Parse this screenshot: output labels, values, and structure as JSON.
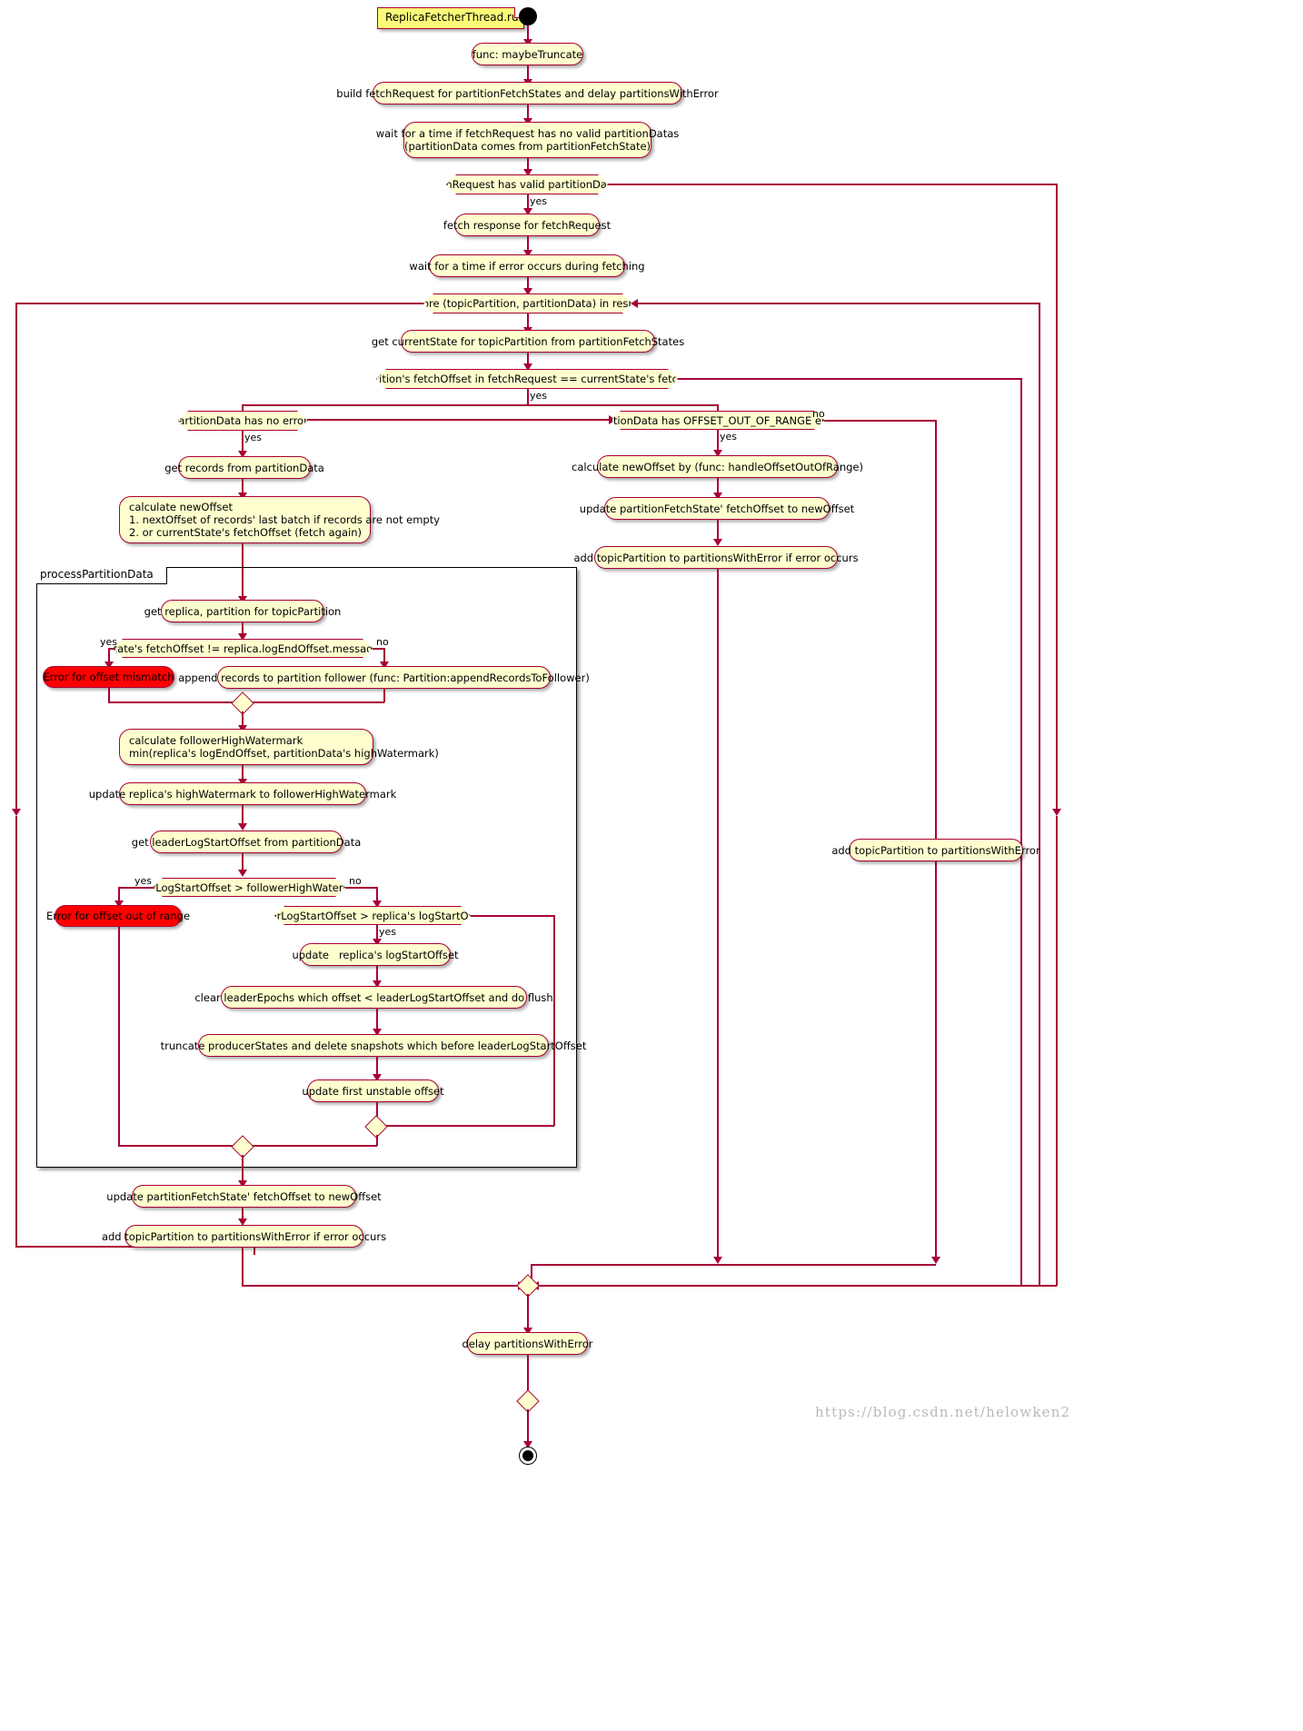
{
  "diagram": {
    "title_note": "ReplicaFetcherThread.run",
    "partition_label": "processPartitionData",
    "watermark": "https://blog.csdn.net/helowken2",
    "colors": {
      "node_fill": "#FEFECE",
      "node_border": "#A80036",
      "note_fill": "#FBFB77",
      "error_fill": "#FF0000",
      "group_border": "#000000"
    }
  },
  "nodes": {
    "maybe_truncate": "func: maybeTruncate",
    "build_fetch_request": "build fetchRequest for partitionFetchStates and delay partitionsWithError",
    "wait_no_valid": "wait for a time if fetchRequest has no valid partitionDatas\n(partitionData comes from partitionFetchState)",
    "cond_valid_partition_datas": "fetchRequest has valid partitionDatas?",
    "fetch_response": "fetch response for fetchRequest",
    "wait_error_fetching": "wait for a time if error occurs during fetching",
    "cond_has_more": "has more (topicPartition, partitionData) in response?",
    "get_current_state": "get currentState for topicPartition from partitionFetchStates",
    "cond_fetchoffset_equal": "topicPartition's fetchOffset in fetchRequest == currentState's fetchOffset?",
    "cond_no_error": "partitionData has no error?",
    "get_records": "get records from partitionData",
    "calculate_new_offset": "calculate newOffset\n1. nextOffset of records' last batch if records are not empty\n2. or currentState's fetchOffset (fetch again)",
    "cond_offset_out_of_range": "partitionData has OFFSET_OUT_OF_RANGE error?",
    "calc_new_offset_handle": "calculate newOffset by (func: handleOffsetOutOfRange)",
    "update_fetchoffset_right": "update partitionFetchState' fetchOffset to newOffset",
    "add_partitions_with_error_right": "add topicPartition to partitionsWithError if error occurs",
    "add_partitions_with_error_far": "add topicPartition to partitionsWithError",
    "get_replica_partition": "get replica, partition for topicPartition",
    "cond_offset_mismatch": "currentState's fetchOffset != replica.logEndOffset.messageOffset?",
    "error_offset_mismatch": "Error for offset mismatch",
    "append_records": "append records to partition follower (func: Partition:appendRecordsToFollower)",
    "calc_follower_hw": "calculate followerHighWatermark\nmin(replica's logEndOffset, partitionData's highWatermark)",
    "update_replica_hw": "update replica's highWatermark to followerHighWatermark",
    "get_leader_log_start_offset": "get leaderLogStartOffset from partitionData",
    "cond_lso_gt_hw": "leaderLogStartOffset > followerHighWatermark?",
    "error_offset_out_of_range": "Error for offset out of range",
    "cond_lso_gt_replica_lso": "leaderLogStartOffset > replica's logStartOffset?",
    "update_replica_lso": "update   replica's logStartOffset",
    "clear_leader_epochs": "clear leaderEpochs which offset < leaderLogStartOffset and do flush",
    "truncate_producer_states": "truncate producerStates and delete snapshots which before leaderLogStartOffset",
    "update_first_unstable": "update first unstable offset",
    "update_fetchoffset_left": "update partitionFetchState' fetchOffset to newOffset",
    "add_partitions_with_error_left": "add topicPartition to partitionsWithError if error occurs",
    "delay_partitions_with_error": "delay partitionsWithError"
  },
  "edge_labels": {
    "yes": "yes",
    "no": "no"
  }
}
